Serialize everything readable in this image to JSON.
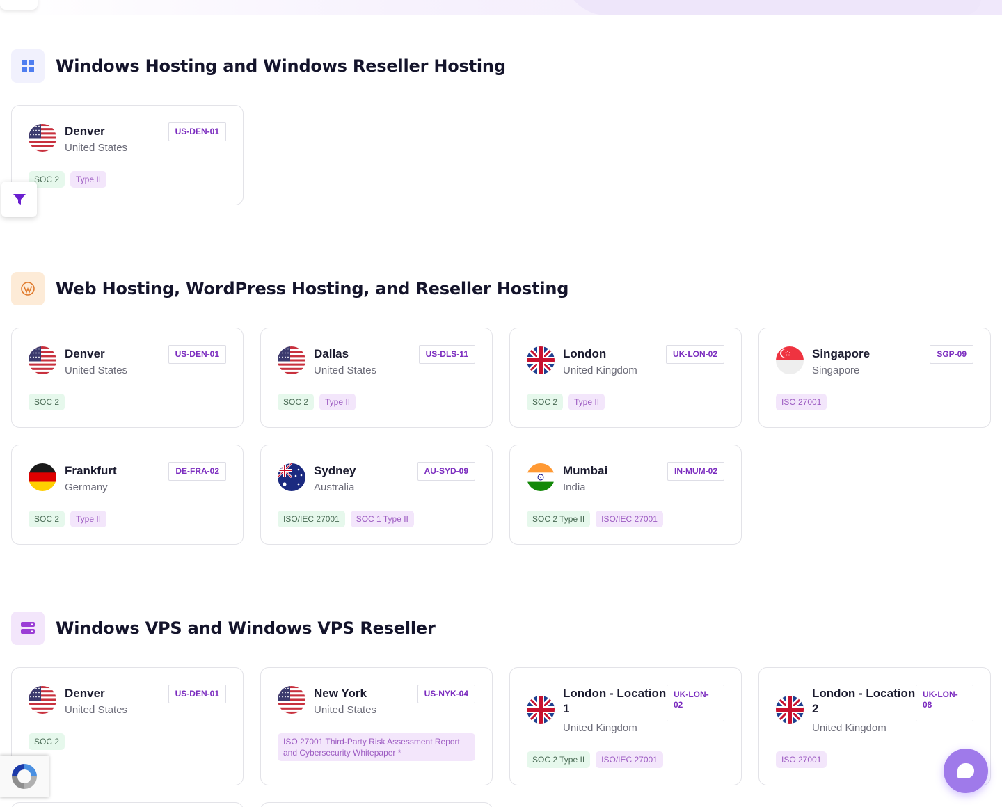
{
  "sections": [
    {
      "title": "Windows Hosting and Windows Reseller Hosting",
      "icon": "windows-icon",
      "cards": [
        {
          "city": "Denver",
          "country": "United States",
          "code": "US-DEN-01",
          "flag": "us-flag-icon",
          "tags": [
            {
              "text": "SOC 2",
              "color": "green"
            },
            {
              "text": "Type II",
              "color": "purple"
            }
          ]
        }
      ]
    },
    {
      "title": "Web Hosting, WordPress Hosting, and Reseller Hosting",
      "icon": "wordpress-icon",
      "cards": [
        {
          "city": "Denver",
          "country": "United States",
          "code": "US-DEN-01",
          "flag": "us-flag-icon",
          "tags": [
            {
              "text": "SOC 2",
              "color": "green"
            }
          ]
        },
        {
          "city": "Dallas",
          "country": "United States",
          "code": "US-DLS-11",
          "flag": "us-flag-icon",
          "tags": [
            {
              "text": "SOC 2",
              "color": "green"
            },
            {
              "text": "Type II",
              "color": "purple"
            }
          ]
        },
        {
          "city": "London",
          "country": "United Kingdom",
          "code": "UK-LON-02",
          "flag": "uk-flag-icon",
          "tags": [
            {
              "text": "SOC 2",
              "color": "green"
            },
            {
              "text": "Type II",
              "color": "purple"
            }
          ]
        },
        {
          "city": "Singapore",
          "country": "Singapore",
          "code": "SGP-09",
          "flag": "sg-flag-icon",
          "tags": [
            {
              "text": "ISO 27001",
              "color": "purple"
            }
          ]
        },
        {
          "city": "Frankfurt",
          "country": "Germany",
          "code": "DE-FRA-02",
          "flag": "de-flag-icon",
          "tags": [
            {
              "text": "SOC 2",
              "color": "green"
            },
            {
              "text": "Type II",
              "color": "purple"
            }
          ]
        },
        {
          "city": "Sydney",
          "country": "Australia",
          "code": "AU-SYD-09",
          "flag": "au-flag-icon",
          "tags": [
            {
              "text": "ISO/IEC 27001",
              "color": "green"
            },
            {
              "text": "SOC 1 Type II",
              "color": "purple"
            }
          ]
        },
        {
          "city": "Mumbai",
          "country": "India",
          "code": "IN-MUM-02",
          "flag": "in-flag-icon",
          "tags": [
            {
              "text": "SOC 2 Type II",
              "color": "green"
            },
            {
              "text": "ISO/IEC 27001",
              "color": "purple"
            }
          ]
        }
      ]
    },
    {
      "title": "Windows VPS and Windows VPS Reseller",
      "icon": "server-icon",
      "cards": [
        {
          "city": "Denver",
          "country": "United States",
          "code": "US-DEN-01",
          "flag": "us-flag-icon",
          "tags": [
            {
              "text": "SOC 2",
              "color": "green"
            }
          ]
        },
        {
          "city": "New York",
          "country": "United States",
          "code": "US-NYK-04",
          "flag": "us-flag-icon",
          "tags": [
            {
              "text": "ISO 27001 Third-Party Risk Assessment Report and Cybersecurity Whitepaper *",
              "color": "purple"
            }
          ]
        },
        {
          "city": "London - Location 1",
          "country": "United Kingdom",
          "code": "UK-LON-02",
          "flag": "uk-flag-icon",
          "tags": [
            {
              "text": "SOC 2 Type II",
              "color": "green"
            },
            {
              "text": "ISO/IEC 27001",
              "color": "purple"
            }
          ]
        },
        {
          "city": "London - Location 2",
          "country": "United Kingdom",
          "code": "UK-LON-08",
          "flag": "uk-flag-icon",
          "tags": [
            {
              "text": "ISO 27001",
              "color": "purple"
            }
          ]
        }
      ]
    }
  ],
  "colors": {
    "accent": "#7b2cbf",
    "chat": "#9f7aea",
    "tag_green_bg": "#e6f8ec",
    "tag_purple_bg": "#f3e6fb"
  },
  "widgets": {
    "filter": "filter-icon",
    "recaptcha": "recaptcha-icon",
    "chat": "chat-icon"
  }
}
